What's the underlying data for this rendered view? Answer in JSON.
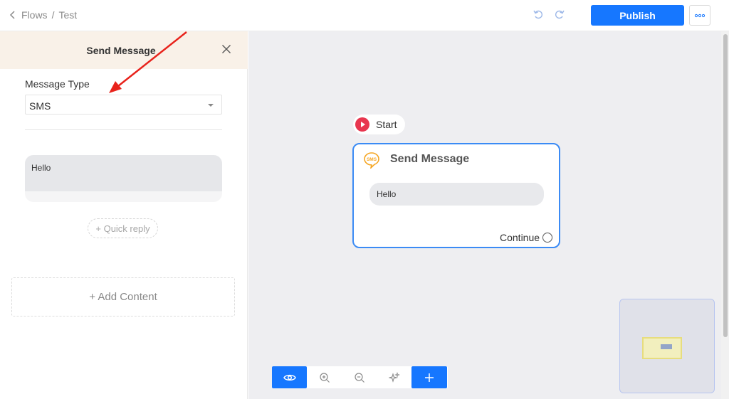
{
  "breadcrumb": {
    "parent": "Flows",
    "separator": "/",
    "current": "Test"
  },
  "header": {
    "publish_label": "Publish"
  },
  "panel": {
    "title": "Send Message",
    "message_type_label": "Message Type",
    "message_type_value": "SMS",
    "message_text": "Hello",
    "quick_reply_label": "+ Quick reply",
    "add_content_label": "+ Add Content"
  },
  "canvas": {
    "start_label": "Start",
    "node": {
      "title": "Send Message",
      "badge_text": "SMS",
      "message": "Hello",
      "continue_label": "Continue"
    }
  },
  "colors": {
    "primary": "#1677ff",
    "panel_header": "#f9f1e8",
    "node_border": "#3b8bf5",
    "start_icon": "#e8364f",
    "sms_icon": "#f5a623",
    "annotation_arrow": "#e8221b"
  },
  "icons": {
    "undo": "undo-icon",
    "redo": "redo-icon",
    "more": "more-dots-icon",
    "close": "close-icon",
    "preview": "eye-icon",
    "zoom_in": "zoom-in-icon",
    "zoom_out": "zoom-out-icon",
    "auto_layout": "sparkle-icon",
    "add": "plus-icon"
  }
}
